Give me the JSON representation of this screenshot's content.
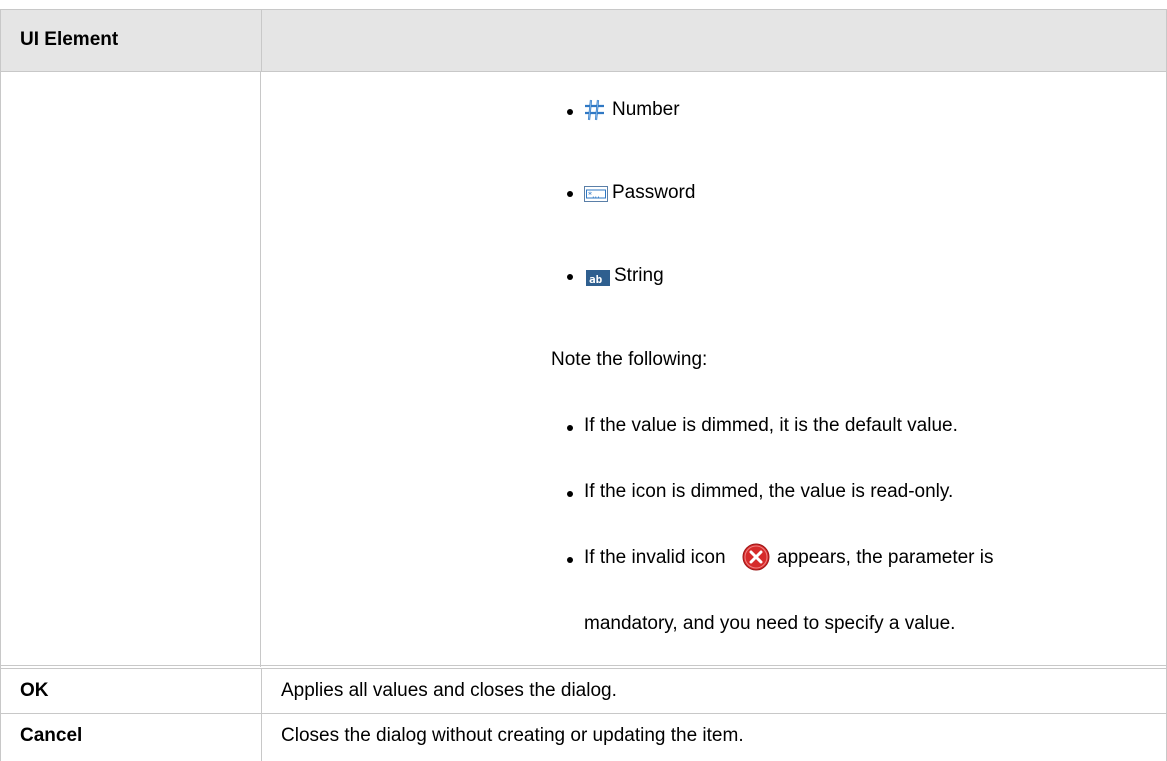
{
  "table": {
    "header": {
      "col1": "UI Element",
      "col2": ""
    },
    "types_list": [
      {
        "icon": "number-icon",
        "label": "Number"
      },
      {
        "icon": "password-icon",
        "label": "Password"
      },
      {
        "icon": "string-icon",
        "label": "String"
      }
    ],
    "note_intro": "Note the following:",
    "notes": {
      "dimmed_value": "If the value is dimmed, it is the default value.",
      "dimmed_icon": "If the icon is dimmed, the value is read-only.",
      "invalid_before": "If the invalid icon",
      "invalid_after": "appears, the parameter is",
      "invalid_line2": "mandatory, and you need to specify a value.",
      "invalid_icon": "invalid-icon"
    },
    "rows": [
      {
        "element": "OK",
        "description": "Applies all values and closes the dialog."
      },
      {
        "element": "Cancel",
        "description": "Closes the dialog without creating or updating the item."
      }
    ]
  },
  "colors": {
    "header_bg": "#e5e5e5",
    "border": "#c8c8c8",
    "icon_blue": "#2f78c4",
    "icon_red": "#d62a2a"
  }
}
